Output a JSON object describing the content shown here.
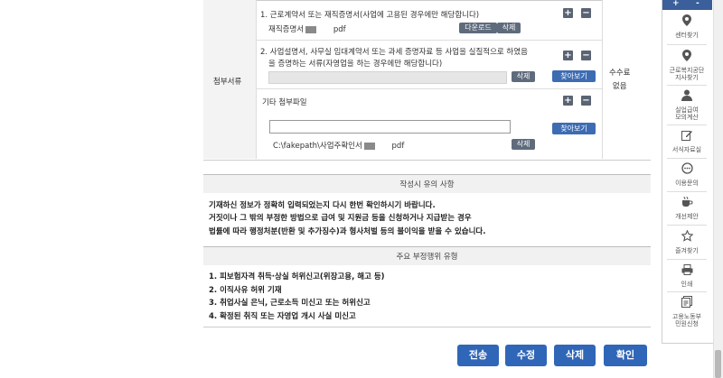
{
  "attachments": {
    "section_label": "첨부서류",
    "fee_label": "수수료\n없음",
    "item1": {
      "title": "1. 근로계약서 또는 재직증명서(사업에 고용된 경우에만 해당합니다)",
      "file_name": "재직증명서",
      "file_ext": "pdf",
      "download_label": "다운로드",
      "delete_label": "삭제"
    },
    "item2": {
      "title_line1": "2. 사업설명서, 사무실 임대계약서 또는 과세 증명자료 등 사업을 실질적으로 하였음",
      "title_line2": "을 증명하는 서류(자영업을 하는 경우에만 해당합니다)",
      "delete_label": "삭제",
      "find_label": "찾아보기"
    },
    "item3": {
      "title": "기타 첨부파일",
      "find_label": "찾아보기",
      "file_path": "C:\\fakepath\\사업주확인서",
      "file_ext": "pdf",
      "delete_label": "삭제"
    },
    "plus_label": "+",
    "minus_label": "−"
  },
  "notice": {
    "heading": "작성시 유의 사항",
    "lines": [
      "기재하신 정보가 정확히 입력되었는지 다시 한번 확인하시기 바랍니다.",
      "거짓이나 그 밖의 부정한 방법으로 급여 및 지원금 등을 신청하거나 지급받는 경우",
      "법률에 따라 행정처분(반환 및 추가징수)과 형사처벌 등의 불이익을 받을 수 있습니다."
    ]
  },
  "fraud": {
    "heading": "주요 부정행위 유형",
    "items": [
      "1. 피보험자격 취득·상실 허위신고(위장고용, 해고 등)",
      "2. 이직사유 허위 기재",
      "3. 취업사실 은닉, 근로소득 미신고 또는 허위신고",
      "4. 확정된 취직 또는 자영업 개시 사실 미신고"
    ]
  },
  "actions": {
    "send": "전송",
    "edit": "수정",
    "delete": "삭제",
    "confirm": "확인"
  },
  "sidebar": {
    "zoom_plus": "+",
    "zoom_minus": "-",
    "items": [
      {
        "label": "센터찾기",
        "icon": "map-pin-icon"
      },
      {
        "label": "근로복지공단\n지사찾기",
        "icon": "map-pin-icon"
      },
      {
        "label": "실업급여\n모의계산",
        "icon": "person-icon"
      },
      {
        "label": "서식자료실",
        "icon": "edit-icon"
      },
      {
        "label": "이용문의",
        "icon": "chat-icon"
      },
      {
        "label": "개선제안",
        "icon": "cup-icon"
      },
      {
        "label": "즐겨찾기",
        "icon": "star-icon"
      },
      {
        "label": "인쇄",
        "icon": "printer-icon"
      },
      {
        "label": "고용노동부\n민원신청",
        "icon": "document-icon"
      }
    ]
  }
}
